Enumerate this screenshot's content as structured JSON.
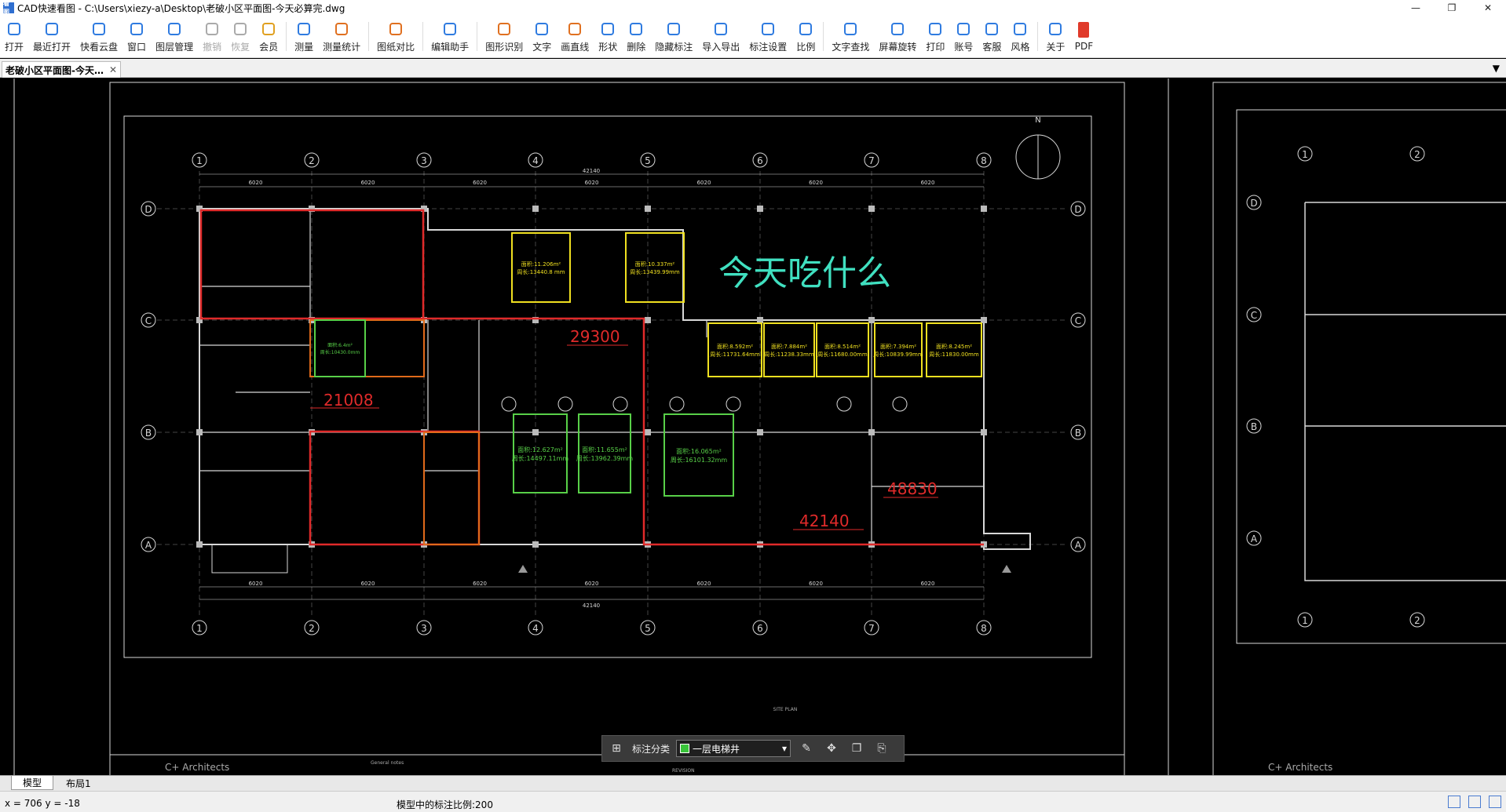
{
  "window": {
    "title": "CAD快速看图 - C:\\Users\\xiezy-a\\Desktop\\老破小区平面图-今天必算完.dwg",
    "app_icon_text": "看图",
    "min": "—",
    "max": "❐",
    "close": "✕"
  },
  "toolbar": [
    {
      "name": "open",
      "label": "打开",
      "icon": "folder-icon",
      "color": "#2f7be0"
    },
    {
      "name": "recent",
      "label": "最近打开",
      "icon": "history-icon",
      "color": "#2f7be0"
    },
    {
      "name": "cloud",
      "label": "快看云盘",
      "icon": "cloud-icon",
      "color": "#2f7be0"
    },
    {
      "name": "window",
      "label": "窗口",
      "icon": "window-icon",
      "color": "#2f7be0"
    },
    {
      "name": "layers",
      "label": "图层管理",
      "icon": "layers-icon",
      "color": "#2f7be0"
    },
    {
      "name": "undo",
      "label": "撤销",
      "icon": "undo-icon",
      "color": "#aaaaaa",
      "disabled": true
    },
    {
      "name": "redo",
      "label": "恢复",
      "icon": "redo-icon",
      "color": "#aaaaaa",
      "disabled": true
    },
    {
      "name": "vip",
      "label": "会员",
      "icon": "vip-icon",
      "color": "#e0a020"
    },
    {
      "name": "measure",
      "label": "测量",
      "icon": "ruler-icon",
      "color": "#2f7be0"
    },
    {
      "name": "measure-stats",
      "label": "测量统计",
      "icon": "chart-icon",
      "color": "#e07020"
    },
    {
      "name": "compare",
      "label": "图纸对比",
      "icon": "compare-icon",
      "color": "#e07020"
    },
    {
      "name": "edit-assist",
      "label": "编辑助手",
      "icon": "edit-icon",
      "color": "#2f7be0"
    },
    {
      "name": "shape-recognize",
      "label": "图形识别",
      "icon": "image-icon",
      "color": "#e07020"
    },
    {
      "name": "text",
      "label": "文字",
      "icon": "text-icon",
      "color": "#2f7be0"
    },
    {
      "name": "line",
      "label": "画直线",
      "icon": "line-icon",
      "color": "#e07020"
    },
    {
      "name": "shape",
      "label": "形状",
      "icon": "shape-icon",
      "color": "#2f7be0"
    },
    {
      "name": "delete",
      "label": "删除",
      "icon": "eraser-icon",
      "color": "#2f7be0"
    },
    {
      "name": "hide-annot",
      "label": "隐藏标注",
      "icon": "eye-off-icon",
      "color": "#2f7be0"
    },
    {
      "name": "import-export",
      "label": "导入导出",
      "icon": "export-icon",
      "color": "#2f7be0"
    },
    {
      "name": "annot-settings",
      "label": "标注设置",
      "icon": "settings-icon",
      "color": "#2f7be0"
    },
    {
      "name": "scale",
      "label": "比例",
      "icon": "scale-icon",
      "color": "#2f7be0"
    },
    {
      "name": "find-text",
      "label": "文字查找",
      "icon": "search-icon",
      "color": "#2f7be0"
    },
    {
      "name": "rotate-screen",
      "label": "屏幕旋转",
      "icon": "rotate-icon",
      "color": "#2f7be0"
    },
    {
      "name": "print",
      "label": "打印",
      "icon": "print-icon",
      "color": "#2f7be0"
    },
    {
      "name": "account",
      "label": "账号",
      "icon": "user-icon",
      "color": "#2f7be0"
    },
    {
      "name": "support",
      "label": "客服",
      "icon": "headset-icon",
      "color": "#2f7be0"
    },
    {
      "name": "style",
      "label": "风格",
      "icon": "style-icon",
      "color": "#2f7be0"
    },
    {
      "name": "about",
      "label": "关于",
      "icon": "info-icon",
      "color": "#2f7be0"
    },
    {
      "name": "pdf",
      "label": "PDF",
      "icon": "pdf-icon",
      "color": "#e03a2a"
    }
  ],
  "doc_tab": {
    "label": "老破小区平面图-今天…",
    "close": "✕"
  },
  "tab_dropdown": "▼",
  "drawing": {
    "grid_cols": [
      "1",
      "2",
      "3",
      "4",
      "5",
      "6",
      "7",
      "8"
    ],
    "grid_rows": [
      "D",
      "C",
      "B",
      "A"
    ],
    "north": "N",
    "title_text": "今天吃什么",
    "dims": {
      "d1": "29300",
      "d2": "21008",
      "d3": "42140",
      "d4": "48830"
    },
    "yellow_rooms": [
      {
        "t1": "面积:11.206m²",
        "t2": "周长:13440.8 mm"
      },
      {
        "t1": "面积:10.337m²",
        "t2": "周长:13439.99mm"
      },
      {
        "t1": "面积:8.592m²",
        "t2": "周长:11731.64mm"
      },
      {
        "t1": "面积:7.884m²",
        "t2": "周长:11238.33mm"
      },
      {
        "t1": "面积:8.514m²",
        "t2": "周长:11680.00mm"
      },
      {
        "t1": "面积:7.394m²",
        "t2": "周长:10839.99mm"
      },
      {
        "t1": "面积:8.245m²",
        "t2": "周长:11830.00mm"
      }
    ],
    "green_rooms": [
      {
        "t1": "面积:12.627m²",
        "t2": "周长:14497.11mm"
      },
      {
        "t1": "面积:11.655m²",
        "t2": "周长:13962.39mm"
      },
      {
        "t1": "面积:16.065m²",
        "t2": "周长:16101.32mm"
      }
    ],
    "small_green": {
      "t1": "面积:6.4m²",
      "t2": "周长:10430.0mm"
    },
    "span_labels": [
      "6020",
      "6020",
      "6020",
      "6020",
      "6020",
      "6020",
      "6020"
    ],
    "total_label": "42140",
    "frame_text_left": "C+ Architects",
    "frame_text_right": "C+ Architects",
    "site_plan": "SITE PLAN",
    "notes_label": "General notes",
    "revision_label": "REVISION"
  },
  "annot_bar": {
    "category_label": "标注分类",
    "selected": "一层电梯井",
    "swatch_color": "#39c43a"
  },
  "bottom_tabs": {
    "model": "模型",
    "layout": "布局1"
  },
  "status": {
    "coord": "x = 706  y = -18",
    "scale": "模型中的标注比例:200"
  }
}
